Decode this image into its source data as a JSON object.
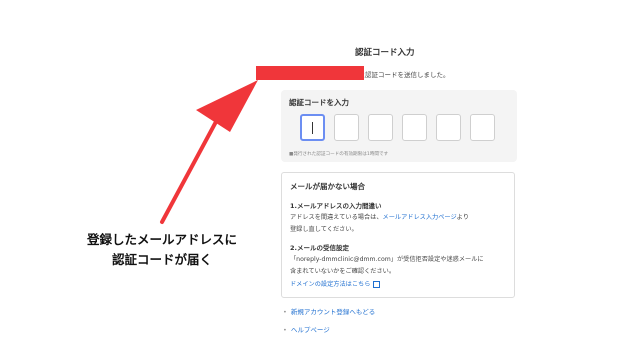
{
  "header": {
    "title": "認証コード入力",
    "sent_message": "宛に認証コードを送信しました。"
  },
  "code_input": {
    "heading": "認証コードを入力",
    "box_count": 6,
    "validity_note": "■発行された認証コードの有効期限は1時間です"
  },
  "help": {
    "title": "メールが届かない場合",
    "section1": {
      "title": "1.メールアドレスの入力間違い",
      "line1_prefix": "アドレスを間違えている場合は、",
      "line1_link": "メールアドレス入力ページ",
      "line1_suffix": "より",
      "line2": "登録し直してください。"
    },
    "section2": {
      "title": "2.メールの受信設定",
      "line1": "「noreply-dmmclinic@dmm.com」が受信拒否設定や迷惑メールに",
      "line2": "含まれていないかをご確認ください。",
      "link": "ドメインの設定方法はこちら"
    }
  },
  "footer_links": [
    {
      "label": "新規アカウント登録へもどる"
    },
    {
      "label": "ヘルプページ"
    }
  ],
  "annotation": {
    "line1": "登録したメールアドレスに",
    "line2": "認証コードが届く"
  },
  "colors": {
    "accent_red": "#f0363a",
    "link_blue": "#1f6fd0",
    "focus_blue": "#6c8ef2"
  }
}
